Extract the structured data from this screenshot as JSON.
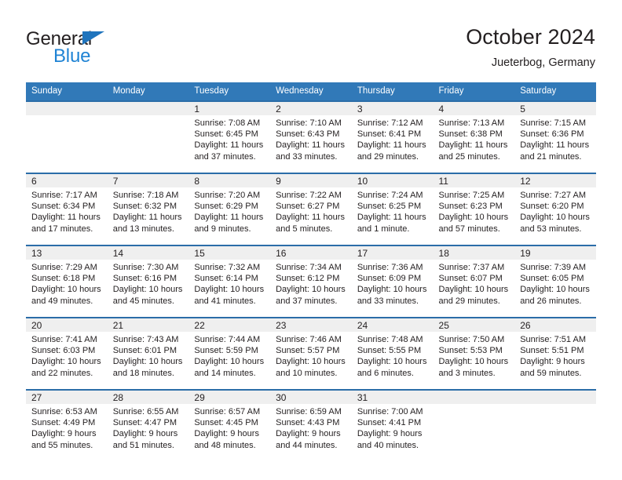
{
  "brand": {
    "name_part1": "General",
    "name_part2": "Blue",
    "triangle_color": "#1f74bd",
    "blue_color": "#1f83d4"
  },
  "header": {
    "title": "October 2024",
    "location": "Jueterbog, Germany",
    "header_bg": "#3179b8",
    "row_divider_color": "#2b6da8",
    "daynum_bg": "#efefef"
  },
  "weekdays": [
    "Sunday",
    "Monday",
    "Tuesday",
    "Wednesday",
    "Thursday",
    "Friday",
    "Saturday"
  ],
  "labels": {
    "sunrise": "Sunrise:",
    "sunset": "Sunset:",
    "daylight": "Daylight:"
  },
  "weeks": [
    [
      {
        "day": ""
      },
      {
        "day": ""
      },
      {
        "day": "1",
        "sunrise": "Sunrise: 7:08 AM",
        "sunset": "Sunset: 6:45 PM",
        "daylight": "Daylight: 11 hours and 37 minutes."
      },
      {
        "day": "2",
        "sunrise": "Sunrise: 7:10 AM",
        "sunset": "Sunset: 6:43 PM",
        "daylight": "Daylight: 11 hours and 33 minutes."
      },
      {
        "day": "3",
        "sunrise": "Sunrise: 7:12 AM",
        "sunset": "Sunset: 6:41 PM",
        "daylight": "Daylight: 11 hours and 29 minutes."
      },
      {
        "day": "4",
        "sunrise": "Sunrise: 7:13 AM",
        "sunset": "Sunset: 6:38 PM",
        "daylight": "Daylight: 11 hours and 25 minutes."
      },
      {
        "day": "5",
        "sunrise": "Sunrise: 7:15 AM",
        "sunset": "Sunset: 6:36 PM",
        "daylight": "Daylight: 11 hours and 21 minutes."
      }
    ],
    [
      {
        "day": "6",
        "sunrise": "Sunrise: 7:17 AM",
        "sunset": "Sunset: 6:34 PM",
        "daylight": "Daylight: 11 hours and 17 minutes."
      },
      {
        "day": "7",
        "sunrise": "Sunrise: 7:18 AM",
        "sunset": "Sunset: 6:32 PM",
        "daylight": "Daylight: 11 hours and 13 minutes."
      },
      {
        "day": "8",
        "sunrise": "Sunrise: 7:20 AM",
        "sunset": "Sunset: 6:29 PM",
        "daylight": "Daylight: 11 hours and 9 minutes."
      },
      {
        "day": "9",
        "sunrise": "Sunrise: 7:22 AM",
        "sunset": "Sunset: 6:27 PM",
        "daylight": "Daylight: 11 hours and 5 minutes."
      },
      {
        "day": "10",
        "sunrise": "Sunrise: 7:24 AM",
        "sunset": "Sunset: 6:25 PM",
        "daylight": "Daylight: 11 hours and 1 minute."
      },
      {
        "day": "11",
        "sunrise": "Sunrise: 7:25 AM",
        "sunset": "Sunset: 6:23 PM",
        "daylight": "Daylight: 10 hours and 57 minutes."
      },
      {
        "day": "12",
        "sunrise": "Sunrise: 7:27 AM",
        "sunset": "Sunset: 6:20 PM",
        "daylight": "Daylight: 10 hours and 53 minutes."
      }
    ],
    [
      {
        "day": "13",
        "sunrise": "Sunrise: 7:29 AM",
        "sunset": "Sunset: 6:18 PM",
        "daylight": "Daylight: 10 hours and 49 minutes."
      },
      {
        "day": "14",
        "sunrise": "Sunrise: 7:30 AM",
        "sunset": "Sunset: 6:16 PM",
        "daylight": "Daylight: 10 hours and 45 minutes."
      },
      {
        "day": "15",
        "sunrise": "Sunrise: 7:32 AM",
        "sunset": "Sunset: 6:14 PM",
        "daylight": "Daylight: 10 hours and 41 minutes."
      },
      {
        "day": "16",
        "sunrise": "Sunrise: 7:34 AM",
        "sunset": "Sunset: 6:12 PM",
        "daylight": "Daylight: 10 hours and 37 minutes."
      },
      {
        "day": "17",
        "sunrise": "Sunrise: 7:36 AM",
        "sunset": "Sunset: 6:09 PM",
        "daylight": "Daylight: 10 hours and 33 minutes."
      },
      {
        "day": "18",
        "sunrise": "Sunrise: 7:37 AM",
        "sunset": "Sunset: 6:07 PM",
        "daylight": "Daylight: 10 hours and 29 minutes."
      },
      {
        "day": "19",
        "sunrise": "Sunrise: 7:39 AM",
        "sunset": "Sunset: 6:05 PM",
        "daylight": "Daylight: 10 hours and 26 minutes."
      }
    ],
    [
      {
        "day": "20",
        "sunrise": "Sunrise: 7:41 AM",
        "sunset": "Sunset: 6:03 PM",
        "daylight": "Daylight: 10 hours and 22 minutes."
      },
      {
        "day": "21",
        "sunrise": "Sunrise: 7:43 AM",
        "sunset": "Sunset: 6:01 PM",
        "daylight": "Daylight: 10 hours and 18 minutes."
      },
      {
        "day": "22",
        "sunrise": "Sunrise: 7:44 AM",
        "sunset": "Sunset: 5:59 PM",
        "daylight": "Daylight: 10 hours and 14 minutes."
      },
      {
        "day": "23",
        "sunrise": "Sunrise: 7:46 AM",
        "sunset": "Sunset: 5:57 PM",
        "daylight": "Daylight: 10 hours and 10 minutes."
      },
      {
        "day": "24",
        "sunrise": "Sunrise: 7:48 AM",
        "sunset": "Sunset: 5:55 PM",
        "daylight": "Daylight: 10 hours and 6 minutes."
      },
      {
        "day": "25",
        "sunrise": "Sunrise: 7:50 AM",
        "sunset": "Sunset: 5:53 PM",
        "daylight": "Daylight: 10 hours and 3 minutes."
      },
      {
        "day": "26",
        "sunrise": "Sunrise: 7:51 AM",
        "sunset": "Sunset: 5:51 PM",
        "daylight": "Daylight: 9 hours and 59 minutes."
      }
    ],
    [
      {
        "day": "27",
        "sunrise": "Sunrise: 6:53 AM",
        "sunset": "Sunset: 4:49 PM",
        "daylight": "Daylight: 9 hours and 55 minutes."
      },
      {
        "day": "28",
        "sunrise": "Sunrise: 6:55 AM",
        "sunset": "Sunset: 4:47 PM",
        "daylight": "Daylight: 9 hours and 51 minutes."
      },
      {
        "day": "29",
        "sunrise": "Sunrise: 6:57 AM",
        "sunset": "Sunset: 4:45 PM",
        "daylight": "Daylight: 9 hours and 48 minutes."
      },
      {
        "day": "30",
        "sunrise": "Sunrise: 6:59 AM",
        "sunset": "Sunset: 4:43 PM",
        "daylight": "Daylight: 9 hours and 44 minutes."
      },
      {
        "day": "31",
        "sunrise": "Sunrise: 7:00 AM",
        "sunset": "Sunset: 4:41 PM",
        "daylight": "Daylight: 9 hours and 40 minutes."
      },
      {
        "day": ""
      },
      {
        "day": ""
      }
    ]
  ]
}
